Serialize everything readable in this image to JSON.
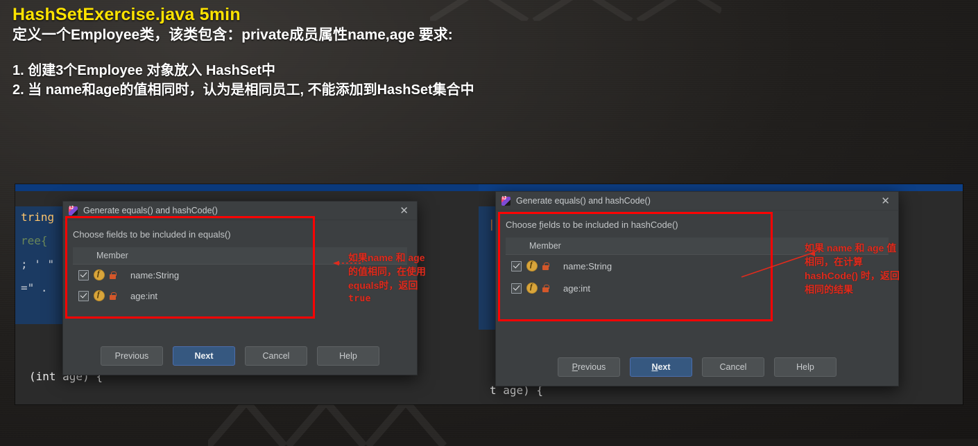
{
  "header": {
    "title": "HashSetExercise.java 5min",
    "subtitle": "定义一个Employee类，该类包含：private成员属性name,age 要求:",
    "items": [
      "1. 创建3个Employee 对象放入 HashSet中",
      "2. 当 name和age的值相同时，认为是相同员工, 不能添加到HashSet集合中"
    ],
    "title_color": "#ffe400",
    "text_color": "#ffffff"
  },
  "screenshot": {
    "left_pane": {
      "editor": {
        "selection_lines": [
          "tring",
          "ree{",
          "; ' \"",
          "=\" ."
        ],
        "bottom_line": "(int age) {"
      },
      "dialog": {
        "icon": "intellij-idea-icon",
        "title": "Generate equals() and hashCode()",
        "close_icon": "close-icon",
        "prompt": "Choose fields to be included in equals()",
        "table": {
          "column_header": "Member",
          "rows": [
            {
              "checked": true,
              "field_icon": "field-icon",
              "access_icon": "private-lock-icon",
              "label": "name:String"
            },
            {
              "checked": true,
              "field_icon": "field-icon",
              "access_icon": "private-lock-icon",
              "label": "age:int"
            }
          ]
        },
        "buttons": [
          {
            "label": "Previous",
            "primary": false,
            "mnemonic": ""
          },
          {
            "label": "Next",
            "primary": true,
            "mnemonic": ""
          },
          {
            "label": "Cancel",
            "primary": false,
            "mnemonic": ""
          },
          {
            "label": "Help",
            "primary": false,
            "mnemonic": ""
          }
        ]
      },
      "annotation": {
        "lines": [
          "如果name 和 age",
          "的值相同，在使用",
          "equals时，返回",
          "true"
        ],
        "color": "#e02b1d"
      }
    },
    "right_pane": {
      "editor": {
        "bottom_line": "t age) {"
      },
      "dialog": {
        "icon": "intellij-idea-icon",
        "title": "Generate equals() and hashCode()",
        "close_icon": "close-icon",
        "prompt_prefix": "Choose ",
        "prompt_mnemonic": "f",
        "prompt_suffix": "ields to be included in hashCode()",
        "table": {
          "column_header": "Member",
          "rows": [
            {
              "checked": true,
              "field_icon": "field-icon",
              "access_icon": "private-lock-icon",
              "label": "name:String"
            },
            {
              "checked": true,
              "field_icon": "field-icon",
              "access_icon": "private-lock-icon",
              "label": "age:int"
            }
          ]
        },
        "buttons": [
          {
            "label_pre": "",
            "mnemonic": "P",
            "label_post": "revious",
            "primary": false
          },
          {
            "label_pre": "",
            "mnemonic": "N",
            "label_post": "ext",
            "primary": true
          },
          {
            "label_pre": "Cancel",
            "mnemonic": "",
            "label_post": "",
            "primary": false
          },
          {
            "label_pre": "Help",
            "mnemonic": "",
            "label_post": "",
            "primary": false
          }
        ]
      },
      "annotation": {
        "lines": [
          "如果 name 和 age 值",
          "相同，在计算",
          "hashCode() 时，返回",
          "相同的结果"
        ],
        "color": "#e02b1d"
      }
    },
    "highlight_box_color": "#fc0303",
    "title_bar_color": "#0b3a7d"
  }
}
